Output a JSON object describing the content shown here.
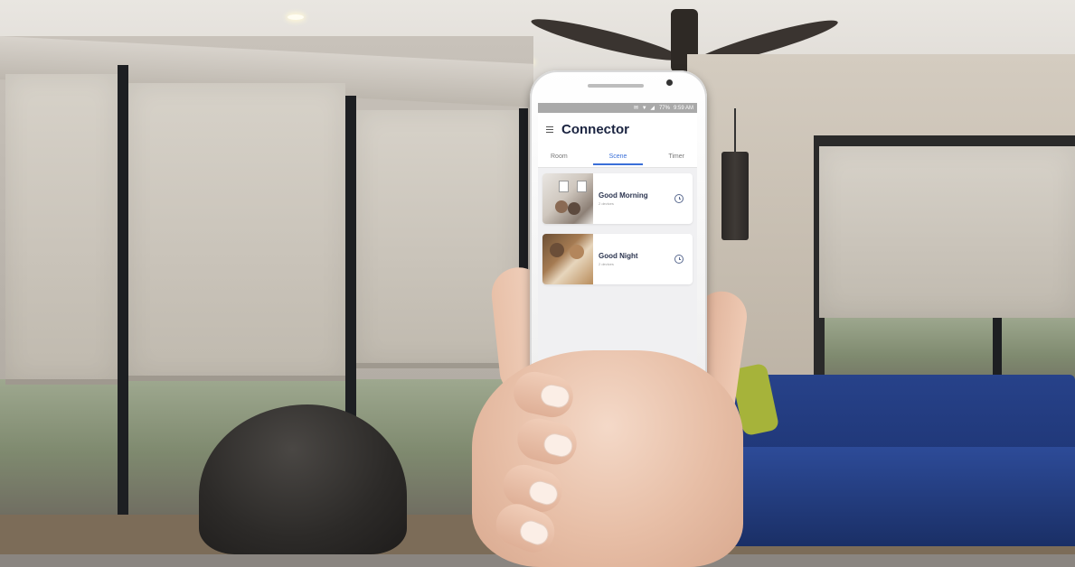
{
  "status_bar": {
    "icons": "✉ ▼ ◢",
    "battery": "77%",
    "time": "9:59 AM"
  },
  "app": {
    "title": "Connector",
    "menu_icon": "hamburger-menu-icon"
  },
  "tabs": [
    {
      "label": "Room",
      "active": false
    },
    {
      "label": "Scene",
      "active": true
    },
    {
      "label": "Timer",
      "active": false
    }
  ],
  "scenes": [
    {
      "name": "Good Morning",
      "subtitle": "2 devices",
      "icon": "clock-icon",
      "thumb": "morning"
    },
    {
      "name": "Good Night",
      "subtitle": "2 devices",
      "icon": "clock-icon",
      "thumb": "night"
    }
  ],
  "colors": {
    "accent": "#3a6fd8",
    "title": "#1a2340",
    "screen_bg": "#f0f0f2",
    "status_bar": "#a9a9a9"
  }
}
